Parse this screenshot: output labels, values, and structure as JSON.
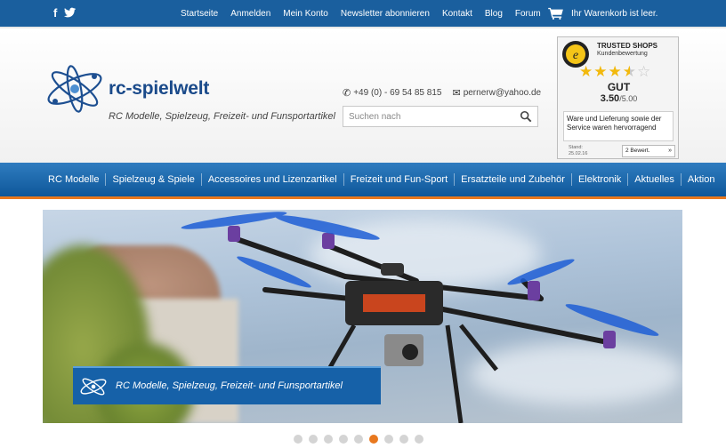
{
  "social": {
    "facebook_icon": "f",
    "twitter_icon": "twitter-bird"
  },
  "topnav": {
    "items": [
      "Startseite",
      "Anmelden",
      "Mein Konto",
      "Newsletter abonnieren",
      "Kontakt",
      "Blog",
      "Forum"
    ],
    "cart_text": "Ihr Warenkorb ist leer."
  },
  "header": {
    "logo_text": "rc-spielwelt",
    "slogan": "RC Modelle, Spielzeug, Freizeit- und Funsportartikel",
    "phone": "+49 (0) - 69 54 85 815",
    "email": "pernerw@yahoo.de",
    "search_placeholder": "Suchen nach"
  },
  "trusted_shops": {
    "title": "TRUSTED SHOPS",
    "subtitle": "Kundenbewertung",
    "rating_stars": 3.5,
    "grade": "GUT",
    "score": "3.50",
    "score_max": "/5.00",
    "review": "Ware und Lieferung sowie der Service waren hervorragend",
    "date_label": "Stand:",
    "date": "25.02.16",
    "count": "2 Bewert."
  },
  "mainnav": {
    "items": [
      "RC Modelle",
      "Spielzeug & Spiele",
      "Accessoires und Lizenzartikel",
      "Freizeit und Fun-Sport",
      "Ersatzteile und Zubehör",
      "Elektronik",
      "Aktuelles",
      "Aktion"
    ]
  },
  "hero": {
    "banner_text": "RC Modelle, Spielzeug, Freizeit- und Funsportartikel",
    "slide_count": 9,
    "active_slide": 6
  },
  "colors": {
    "brand_blue": "#1a5f9e",
    "accent_orange": "#e8781e"
  }
}
